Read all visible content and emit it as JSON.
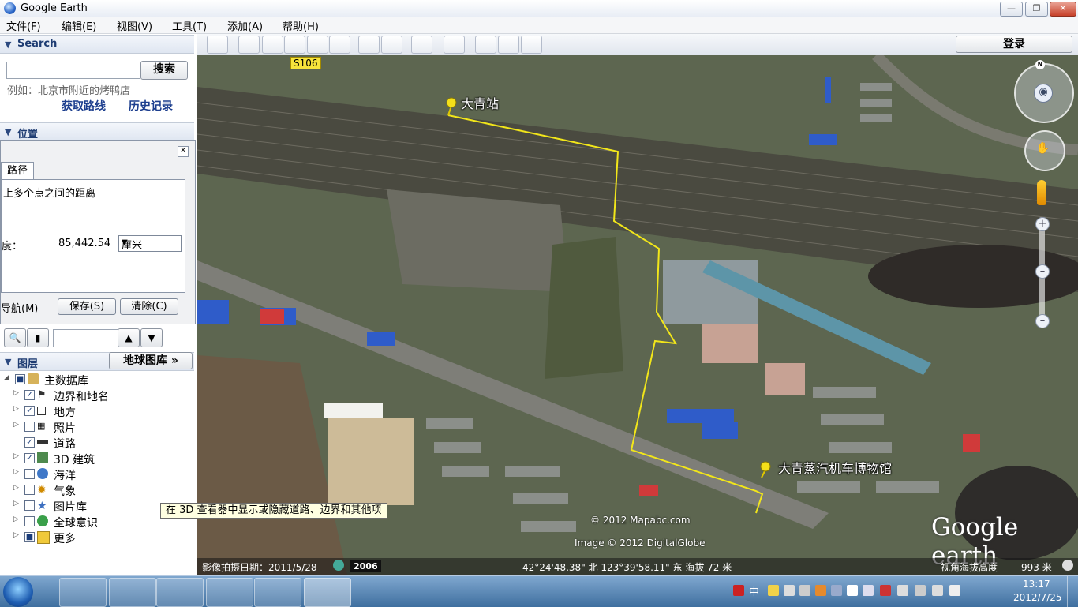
{
  "window": {
    "title": "Google Earth"
  },
  "menu": [
    "文件(F)",
    "编辑(E)",
    "视图(V)",
    "工具(T)",
    "添加(A)",
    "帮助(H)"
  ],
  "search": {
    "header": "Search",
    "button": "搜索",
    "placeholder": "",
    "hint": "例如：北京市附近的烤鸭店",
    "get_directions": "获取路线",
    "history": "历史记录"
  },
  "places": {
    "header": "位置"
  },
  "ruler": {
    "tab": "路径",
    "description": "上多个点之间的距离",
    "length_label": "度：",
    "length_value": "85,442.54",
    "unit": "厘米",
    "nav_label": "导航(M)",
    "save": "保存(S)",
    "clear": "清除(C)"
  },
  "layers": {
    "header": "图层",
    "gallery_button": "地球图库 »",
    "items": [
      {
        "name": "主数据库",
        "checked": "■"
      },
      {
        "name": "边界和地名",
        "checked": "✓"
      },
      {
        "name": "地方",
        "checked": "✓"
      },
      {
        "name": "照片",
        "checked": ""
      },
      {
        "name": "道路",
        "checked": "✓"
      },
      {
        "name": "3D 建筑",
        "checked": "✓"
      },
      {
        "name": "海洋",
        "checked": ""
      },
      {
        "name": "气象",
        "checked": ""
      },
      {
        "name": "图片库",
        "checked": ""
      },
      {
        "name": "全球意识",
        "checked": ""
      },
      {
        "name": "更多",
        "checked": "■"
      }
    ]
  },
  "toolbar": {
    "login": "登录"
  },
  "map": {
    "road_badge": "S106",
    "placemark_1": "大青站",
    "placemark_2": "大青蒸汽机车博物馆",
    "copyright_1": "© 2012 Mapabc.com",
    "copyright_2": "Image © 2012 DigitalGlobe",
    "logo": "Google earth",
    "path_color": "#f2e61a"
  },
  "status": {
    "imagery_date": "影像拍摄日期：2011/5/28",
    "year": "2006",
    "coords": "42°24'48.38\" 北  123°39'58.11\" 东  海拔   72 米",
    "eye_alt_label": "视角海拔高度",
    "eye_alt_value": "993 米"
  },
  "tooltip": "在 3D 查看器中显示或隐藏道路、边界和其他项",
  "taskbar": {
    "time": "13:17",
    "date": "2012/7/25",
    "ime": "中"
  }
}
